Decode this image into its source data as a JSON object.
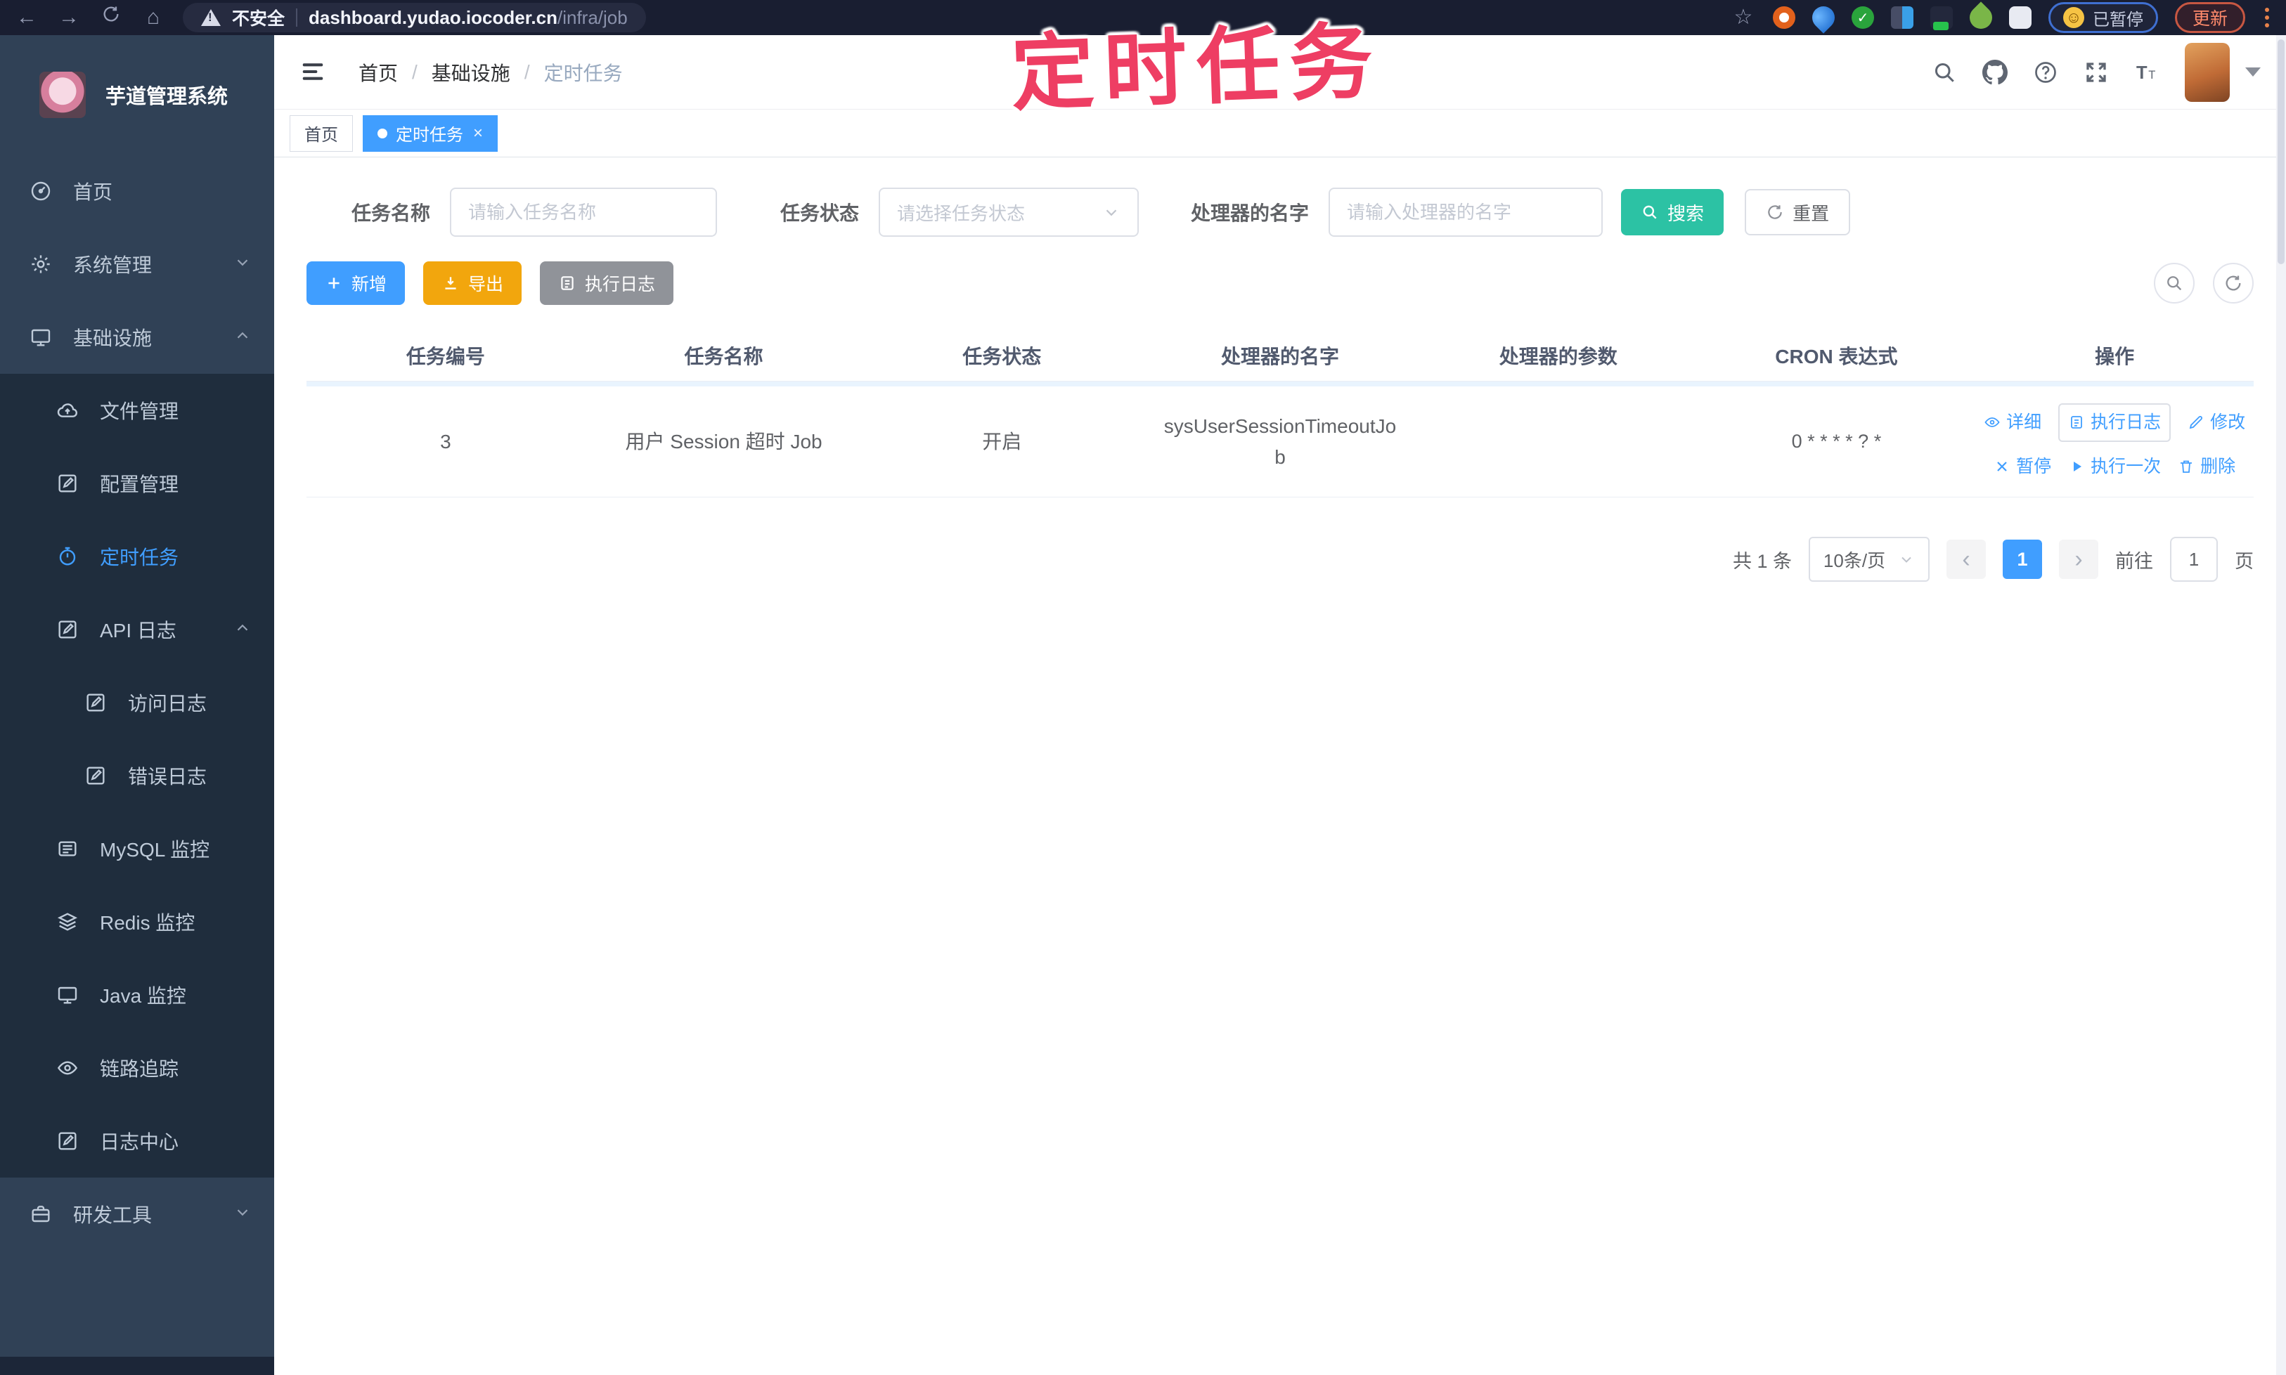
{
  "browser": {
    "security_label": "不安全",
    "url_host": "dashboard.yudao.iocoder.cn",
    "url_path": "/infra/job",
    "paused_label": "已暂停",
    "update_label": "更新"
  },
  "annotation": {
    "text": "定时任务",
    "color": "#ee3e63"
  },
  "sidebar": {
    "app_title": "芋道管理系统",
    "items": [
      {
        "label": "首页",
        "icon": "dashboard-icon"
      },
      {
        "label": "系统管理",
        "icon": "gear-icon",
        "arrow": "down"
      },
      {
        "label": "基础设施",
        "icon": "monitor-icon",
        "arrow": "up"
      },
      {
        "label": "文件管理",
        "icon": "cloud-upload-icon"
      },
      {
        "label": "配置管理",
        "icon": "edit-icon"
      },
      {
        "label": "定时任务",
        "icon": "timer-icon",
        "active": true
      },
      {
        "label": "API 日志",
        "icon": "log-icon",
        "arrow": "up"
      },
      {
        "label": "访问日志",
        "icon": "log-icon"
      },
      {
        "label": "错误日志",
        "icon": "log-icon"
      },
      {
        "label": "MySQL 监控",
        "icon": "database-monitor-icon"
      },
      {
        "label": "Redis 监控",
        "icon": "layers-icon"
      },
      {
        "label": "Java 监控",
        "icon": "java-monitor-icon"
      },
      {
        "label": "链路追踪",
        "icon": "eye-icon"
      },
      {
        "label": "日志中心",
        "icon": "log-icon"
      },
      {
        "label": "研发工具",
        "icon": "briefcase-icon",
        "arrow": "down"
      }
    ]
  },
  "header": {
    "breadcrumb": [
      "首页",
      "基础设施",
      "定时任务"
    ],
    "icons": [
      "search-icon",
      "github-icon",
      "help-icon",
      "fullscreen-icon",
      "font-size-icon",
      "avatar",
      "caret-down-icon"
    ]
  },
  "tags": {
    "home": "首页",
    "active": "定时任务",
    "close": "×"
  },
  "filters": {
    "task_name_label": "任务名称",
    "task_name_placeholder": "请输入任务名称",
    "task_status_label": "任务状态",
    "task_status_placeholder": "请选择任务状态",
    "handler_label": "处理器的名字",
    "handler_placeholder": "请输入处理器的名字",
    "search_label": "搜索",
    "reset_label": "重置"
  },
  "toolbar": {
    "add_label": "新增",
    "export_label": "导出",
    "exec_log_label": "执行日志"
  },
  "table": {
    "headers": [
      "任务编号",
      "任务名称",
      "任务状态",
      "处理器的名字",
      "处理器的参数",
      "CRON 表达式",
      "操作"
    ],
    "row": {
      "id": "3",
      "name": "用户 Session 超时 Job",
      "status": "开启",
      "handler_line1": "sysUserSessionTimeoutJo",
      "handler_line2": "b",
      "param": "",
      "cron": "0 * * * * ? *",
      "action_detail": "详细",
      "action_exec_log": "执行日志",
      "action_modify": "修改",
      "action_pause": "暂停",
      "action_run_once": "执行一次",
      "action_delete": "删除"
    }
  },
  "pagination": {
    "total": "共 1 条",
    "page_size": "10条/页",
    "prev": "‹",
    "current": "1",
    "next": "›",
    "goto_label": "前往",
    "goto_value": "1",
    "page_unit": "页"
  },
  "colors": {
    "accent_blue": "#409eff",
    "search_teal": "#2cc2a4",
    "export_orange": "#f2a60d",
    "exec_gray": "#909399",
    "sidebar_bg": "#304156",
    "submenu_bg": "#1f2d3d",
    "chrome_bg": "#191e31"
  }
}
